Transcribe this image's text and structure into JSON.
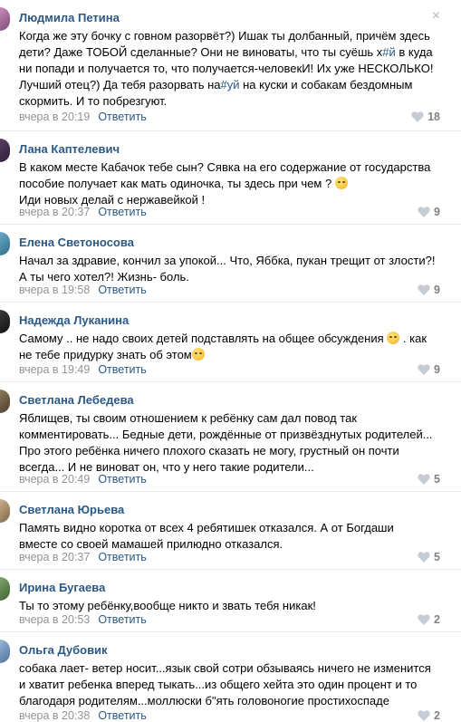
{
  "comments": [
    {
      "author": "Людмила Петина",
      "text_before": "Когда же эту бочку с говном разорвёт?) Ишак ты долбанный, причём здесь\nдети? Даже ТОБОЙ сделанные? Они не виноваты, что ты суёшь х",
      "hashtag1": "#й",
      "text_mid": " в куда\nни попади и получается то, что получается-человекИ! Их уже НЕСКОЛЬКО!\nЛучший отец?) Да тебя разорвать на",
      "hashtag2": "#уй",
      "text_after": " на куски и собакам бездомным\nскормить. И то побрезгуют.",
      "date": "вчера в 20:19",
      "reply": "Ответить",
      "likes": "18",
      "close_icon": "×"
    },
    {
      "author": "Лана Каптелевич",
      "text": "В каком месте Кабачок тебе сын? Сявка на его содержание от государства\nпособие получает как мать одиночка, ты здесь при чем ?",
      "text_after": "\nИди новых делай с нержавейкой !",
      "date": "вчера в 20:37",
      "reply": "Ответить",
      "likes": "9"
    },
    {
      "author": "Елена Светоносова",
      "text": "Начал за здравие, кончил за упокой... Что, Яббка, пукан трещит от злости?!\nА ты чего хотел?! Жизнь- боль.",
      "date": "вчера в 19:58",
      "reply": "Ответить",
      "likes": "9"
    },
    {
      "author": "Надежда Луканина",
      "text": "Самому .. не надо своих детей подставлять на общее обсуждения",
      "text_mid": " . как\nне тебе придурку знать об этом",
      "date": "вчера в 19:49",
      "reply": "Ответить",
      "likes": "9"
    },
    {
      "author": "Светлана Лебедева",
      "text": "Яблищев, ты своим отношением к ребёнку сам дал повод так\nкомментировать... Бедные дети, рождённые от призвёзднутых родителей...\nПро этого ребёнка ничего плохого сказать не могу, грустный он почти\nвсегда... И не виноват он, что у него такие родители...",
      "date": "вчера в 20:49",
      "reply": "Ответить",
      "likes": "5"
    },
    {
      "author": "Светлана Юрьева",
      "text": "Память видно коротка от всех 4 ребятишек отказался. А от Богдаши\nвместе со своей мамашей прилюдно отказался.",
      "date": "вчера в 20:37",
      "reply": "Ответить",
      "likes": "5"
    },
    {
      "author": "Ирина Бугаева",
      "text": "Ты то этому ребёнку,вообще никто и звать тебя никак!",
      "date": "вчера в 20:53",
      "reply": "Ответить",
      "likes": "2"
    },
    {
      "author": "Ольга Дубовик",
      "text": "собака лает- ветер носит...язык свой сотри обзываясь ничего не изменится\nи хватит ребенка вперед тыкать...из общего хейта это один процент и то\nблагодаря родителям...моллюски б\"ять головоногие простихоспаде",
      "date": "вчера в 20:38",
      "reply": "Ответить",
      "likes": "2"
    }
  ],
  "colors": {
    "link": "#2a5885",
    "meta": "#939393",
    "likes": "#828282",
    "divider": "#e7e8ec"
  },
  "icons": {
    "like": "heart-icon",
    "close": "close-icon",
    "emoji": "smiley-emoji-icon"
  }
}
